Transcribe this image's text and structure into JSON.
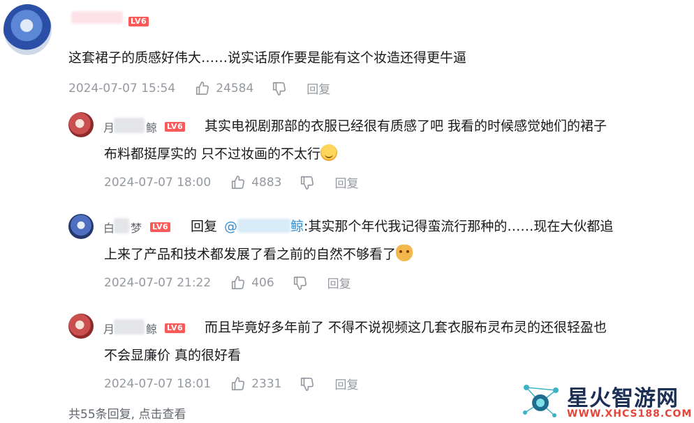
{
  "comments": [
    {
      "username_visible": "",
      "level": "LV6",
      "text": "这套裙子的质感好伟大……说实话原作要是能有这个妆造还得更牛逼",
      "time": "2024-07-07 15:54",
      "likes": "24584",
      "reply_label": "回复"
    },
    {
      "username_visible_start": "月",
      "username_visible_end": "鲸",
      "level": "LV6",
      "text_line1": "其实电视剧那部的衣服已经很有质感了吧 我看的时候感觉她们的裙子",
      "text_line2": "布料都挺厚实的 只不过妆画的不太行",
      "time": "2024-07-07 18:00",
      "likes": "4883",
      "reply_label": "回复"
    },
    {
      "username_visible_start": "白",
      "username_visible_end": "梦",
      "level": "LV6",
      "reply_prefix": "回复",
      "mention_start": "@",
      "mention_end": "鲸",
      "text_line1": ":其实那个年代我记得蛮流行那种的……现在大伙都追",
      "text_line2": "上来了产品和技术都发展了看之前的自然不够看了",
      "time": "2024-07-07 21:22",
      "likes": "406",
      "reply_label": "回复"
    },
    {
      "username_visible_start": "月",
      "username_visible_end": "鲸",
      "level": "LV6",
      "text_line1": "而且毕竟好多年前了 不得不说视频这几套衣服布灵布灵的还很轻盈也",
      "text_line2": "不会显廉价 真的很好看",
      "time": "2024-07-07 18:01",
      "likes": "2331",
      "reply_label": "回复"
    }
  ],
  "footer": {
    "text": "共55条回复, 点击查看"
  },
  "watermark": {
    "title": "星火智游网",
    "url": "WWW.XHCS188.COM"
  },
  "icons": {
    "like": "thumbs-up-icon",
    "dislike": "thumbs-down-icon",
    "emoji_laugh": "laugh-emoji-icon",
    "emoji_cat": "cat-emoji-icon"
  },
  "colors": {
    "level_badge": "#fb5a5a",
    "mention": "#2d8fd5",
    "meta": "#9499a0"
  }
}
